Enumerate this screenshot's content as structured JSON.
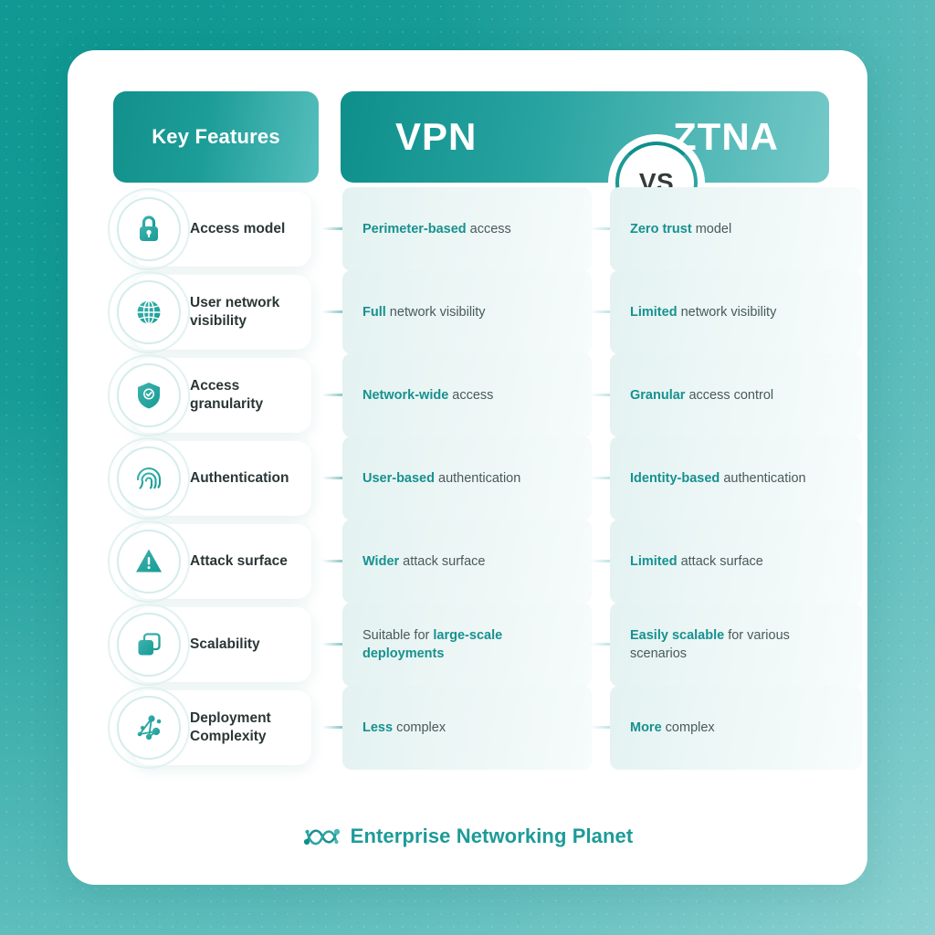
{
  "header": {
    "key_features_label": "Key Features",
    "vpn_label": "VPN",
    "vs_label": "VS",
    "ztna_label": "ZTNA"
  },
  "colors": {
    "background_dark_teal": "#0f9792",
    "background_light_teal": "#8ed2d2",
    "card_white": "#ffffff",
    "accent_teal": "#17918f",
    "header_gradient_start": "#0e8f8b",
    "header_gradient_end": "#74c9c8",
    "vpn_dot": "#0d8a85",
    "ztna_dot": "#7cc7c7",
    "body_text": "#49595a",
    "label_text": "#2b3636"
  },
  "rows": [
    {
      "icon": "lock-icon",
      "feature": "Access model",
      "vpn": {
        "bold": "Perimeter-based",
        "rest": " access",
        "bold_first": true
      },
      "ztna": {
        "bold": "Zero trust",
        "rest": " model",
        "bold_first": true
      }
    },
    {
      "icon": "globe-icon",
      "feature": "User network visibility",
      "vpn": {
        "bold": "Full",
        "rest": " network visibility",
        "bold_first": true
      },
      "ztna": {
        "bold": "Limited",
        "rest": " network visibility",
        "bold_first": true
      }
    },
    {
      "icon": "shield-check-icon",
      "feature": "Access granularity",
      "vpn": {
        "bold": "Network-wide",
        "rest": " access",
        "bold_first": true
      },
      "ztna": {
        "bold": "Granular",
        "rest": " access control",
        "bold_first": true
      }
    },
    {
      "icon": "fingerprint-icon",
      "feature": "Authentication",
      "vpn": {
        "bold": "User-based",
        "rest": " authentication",
        "bold_first": true
      },
      "ztna": {
        "bold": "Identity-based",
        "rest": " authentication",
        "bold_first": true
      }
    },
    {
      "icon": "warning-triangle-icon",
      "feature": "Attack surface",
      "vpn": {
        "bold": "Wider",
        "rest": " attack surface",
        "bold_first": true
      },
      "ztna": {
        "bold": "Limited",
        "rest": " attack surface",
        "bold_first": true
      }
    },
    {
      "icon": "layers-icon",
      "feature": "Scalability",
      "vpn": {
        "bold": "large-scale deployments",
        "rest": "Suitable for ",
        "bold_first": false
      },
      "ztna": {
        "bold": "Easily scalable",
        "rest": " for various scenarios",
        "bold_first": true
      }
    },
    {
      "icon": "network-nodes-icon",
      "feature": "Deployment Complexity",
      "vpn": {
        "bold": "Less",
        "rest": " complex",
        "bold_first": true
      },
      "ztna": {
        "bold": "More",
        "rest": " complex",
        "bold_first": true
      }
    }
  ],
  "footer": {
    "logo_icon": "enterprise-networking-planet-logo",
    "brand": "Enterprise Networking Planet"
  }
}
